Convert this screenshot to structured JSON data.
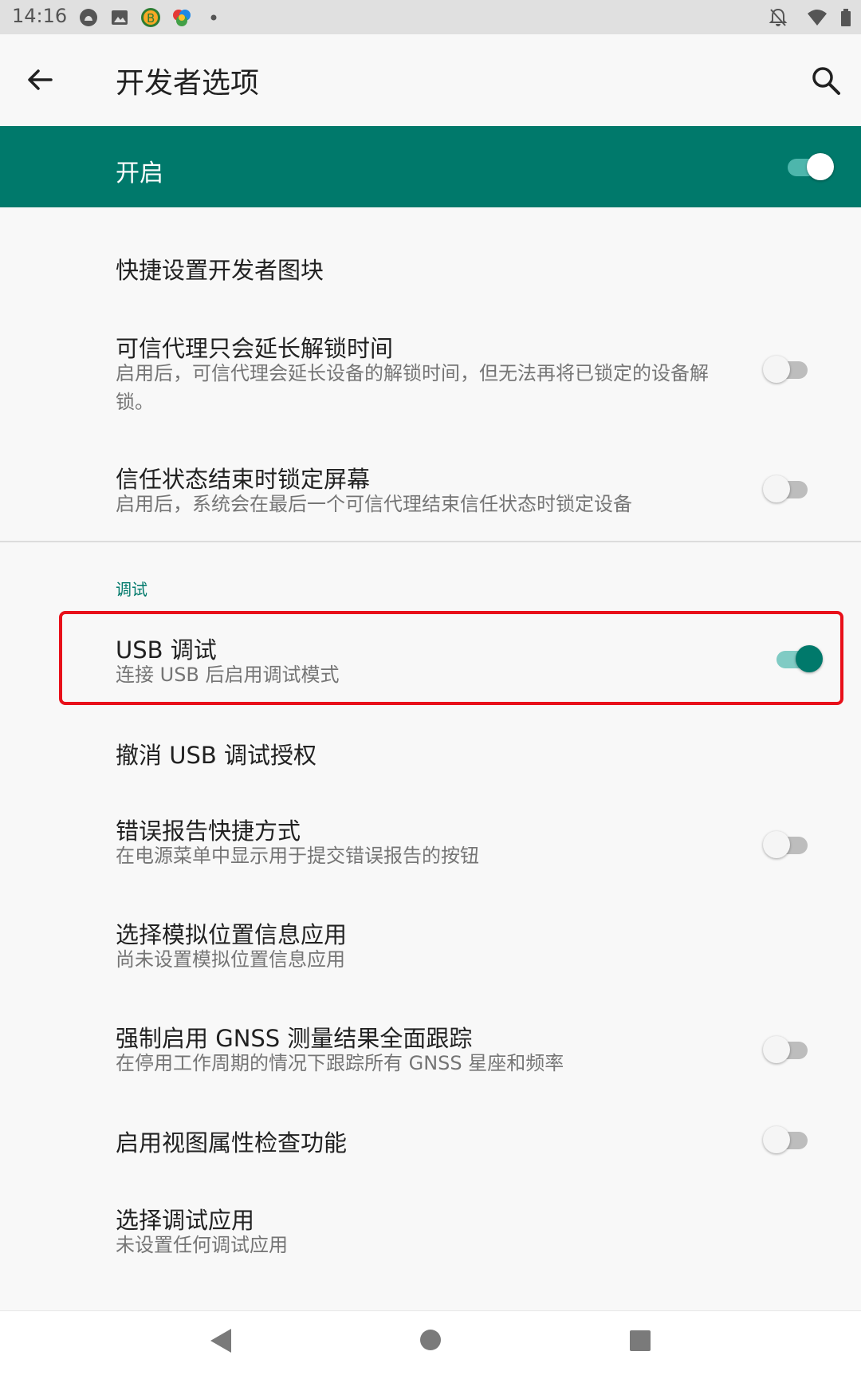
{
  "status_bar": {
    "time": "14:16",
    "icons": [
      "blob-icon",
      "image-icon",
      "b-coin-icon",
      "colorful-app-icon",
      "dot-icon",
      "bell-off-icon",
      "wifi-icon",
      "battery-icon"
    ]
  },
  "toolbar": {
    "title": "开发者选项",
    "back_icon": "arrow-left-icon",
    "search_icon": "search-icon"
  },
  "master_switch": {
    "label": "开启",
    "state": true
  },
  "colors": {
    "accent": "#00796b",
    "highlight": "#e8101a"
  },
  "items_top": [
    {
      "title": "快捷设置开发者图块",
      "summary": ""
    },
    {
      "title": "可信代理只会延长解锁时间",
      "summary": "启用后，可信代理会延长设备的解锁时间，但无法再将已锁定的设备解锁。",
      "switch": false
    },
    {
      "title": "信任状态结束时锁定屏幕",
      "summary": "启用后，系统会在最后一个可信代理结束信任状态时锁定设备",
      "switch": false
    }
  ],
  "debug_section": {
    "header": "调试",
    "items": [
      {
        "title": "USB 调试",
        "summary": "连接 USB 后启用调试模式",
        "switch": true
      },
      {
        "title": "撤消 USB 调试授权",
        "summary": ""
      },
      {
        "title": "错误报告快捷方式",
        "summary": "在电源菜单中显示用于提交错误报告的按钮",
        "switch": false
      },
      {
        "title": "选择模拟位置信息应用",
        "summary": "尚未设置模拟位置信息应用"
      },
      {
        "title": "强制启用 GNSS 测量结果全面跟踪",
        "summary": "在停用工作周期的情况下跟踪所有 GNSS 星座和频率",
        "switch": false
      },
      {
        "title": "启用视图属性检查功能",
        "summary": "",
        "switch": false
      },
      {
        "title": "选择调试应用",
        "summary": "未设置任何调试应用"
      }
    ]
  },
  "nav_bar": [
    "back-triangle-icon",
    "home-circle-icon",
    "recents-square-icon"
  ]
}
